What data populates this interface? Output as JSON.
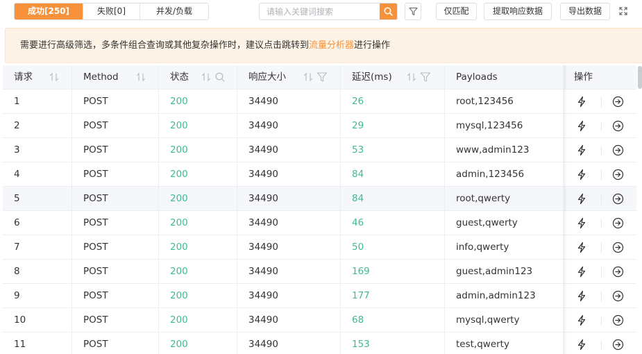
{
  "toolbar": {
    "tabs": [
      {
        "label": "成功[250]",
        "active": true
      },
      {
        "label": "失败[0]",
        "active": false
      },
      {
        "label": "并发/负载",
        "active": false
      }
    ],
    "search_placeholder": "请输入关键词搜索",
    "search_value": "",
    "match_only_label": "仅匹配",
    "extract_label": "提取响应数据",
    "export_label": "导出数据",
    "icons": [
      "search-icon",
      "filter-icon",
      "fullscreen-icon"
    ]
  },
  "notice": {
    "text_before": "需要进行高级筛选，多条件组合查询或其他复杂操作时，建议点击跳转到",
    "link_text": "流量分析器",
    "text_after": "进行操作"
  },
  "table": {
    "columns": [
      {
        "label": "请求",
        "icons": [
          "sort-icon"
        ]
      },
      {
        "label": "Method",
        "icons": [
          "sort-icon"
        ]
      },
      {
        "label": "状态",
        "icons": [
          "sort-icon",
          "search-icon"
        ]
      },
      {
        "label": "响应大小",
        "icons": [
          "sort-icon",
          "filter-icon"
        ]
      },
      {
        "label": "延迟(ms)",
        "icons": [
          "sort-icon",
          "filter-icon"
        ]
      },
      {
        "label": "Payloads",
        "icons": []
      },
      {
        "label": "操作",
        "icons": []
      }
    ],
    "rows": [
      {
        "id": "1",
        "method": "POST",
        "status": "200",
        "size": "34490",
        "delay": "26",
        "payload": "root,123456"
      },
      {
        "id": "2",
        "method": "POST",
        "status": "200",
        "size": "34490",
        "delay": "29",
        "payload": "mysql,123456"
      },
      {
        "id": "3",
        "method": "POST",
        "status": "200",
        "size": "34490",
        "delay": "53",
        "payload": "www,admin123"
      },
      {
        "id": "4",
        "method": "POST",
        "status": "200",
        "size": "34490",
        "delay": "84",
        "payload": "admin,123456"
      },
      {
        "id": "5",
        "method": "POST",
        "status": "200",
        "size": "34490",
        "delay": "84",
        "payload": "root,qwerty"
      },
      {
        "id": "6",
        "method": "POST",
        "status": "200",
        "size": "34490",
        "delay": "46",
        "payload": "guest,qwerty"
      },
      {
        "id": "7",
        "method": "POST",
        "status": "200",
        "size": "34490",
        "delay": "50",
        "payload": "info,qwerty"
      },
      {
        "id": "8",
        "method": "POST",
        "status": "200",
        "size": "34490",
        "delay": "169",
        "payload": "guest,admin123"
      },
      {
        "id": "9",
        "method": "POST",
        "status": "200",
        "size": "34490",
        "delay": "177",
        "payload": "admin,admin123"
      },
      {
        "id": "10",
        "method": "POST",
        "status": "200",
        "size": "34490",
        "delay": "68",
        "payload": "mysql,qwerty"
      },
      {
        "id": "11",
        "method": "POST",
        "status": "200",
        "size": "34490",
        "delay": "153",
        "payload": "test,qwerty"
      }
    ],
    "row_actions": [
      "bolt-icon",
      "arrow-circle-right-icon"
    ]
  },
  "colors": {
    "accent": "#f7923a",
    "status_green": "#3dbb92",
    "notice_bg": "#fdf3e7",
    "header_bg": "#f5f7fa"
  }
}
